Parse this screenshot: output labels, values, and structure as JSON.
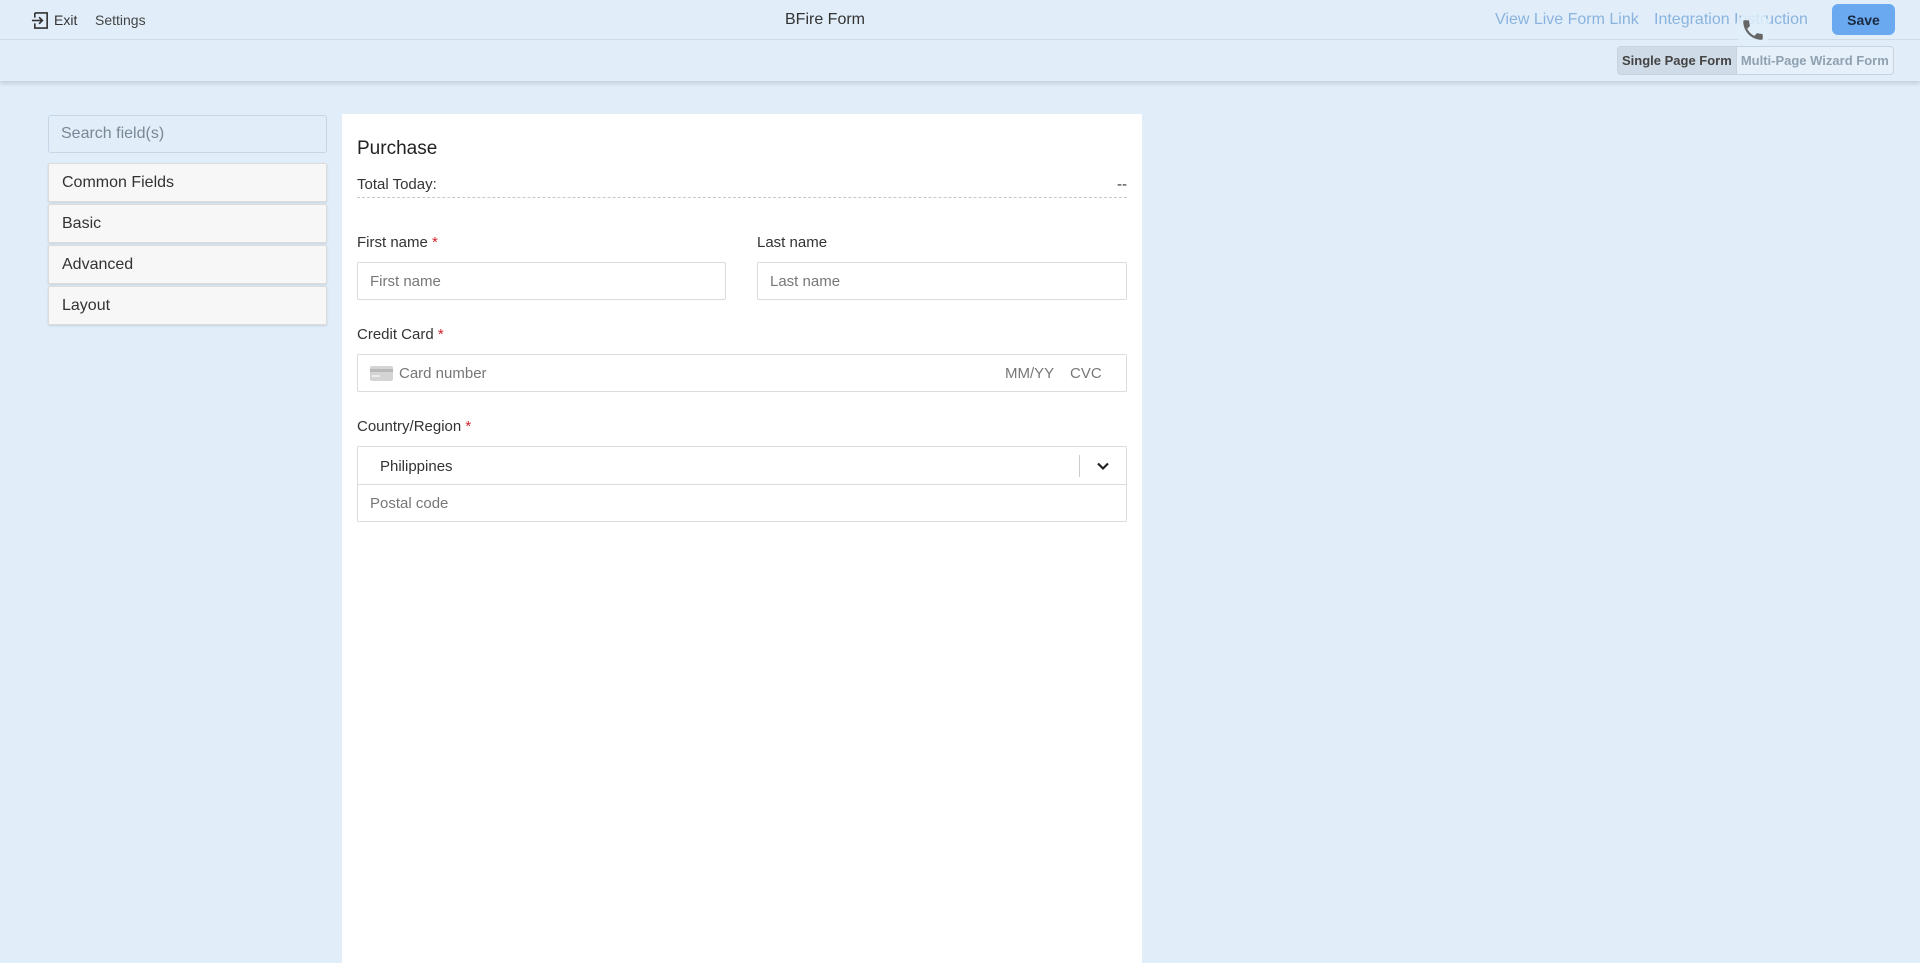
{
  "header": {
    "exit_label": "Exit",
    "settings_label": "Settings",
    "title": "BFire Form",
    "live_link_label": "View Live Form Link",
    "integration_label": "Integration Instruction",
    "save_label": "Save"
  },
  "mode_toggle": {
    "single_page_label": "Single Page Form",
    "multi_page_label": "Multi-Page Wizard Form",
    "active": "Single Page Form"
  },
  "sidebar": {
    "search_placeholder": "Search field(s)",
    "categories": [
      {
        "label": "Common Fields"
      },
      {
        "label": "Basic"
      },
      {
        "label": "Advanced"
      },
      {
        "label": "Layout"
      }
    ]
  },
  "form": {
    "title": "Purchase",
    "total_label": "Total Today:",
    "total_value": "--",
    "first_name": {
      "label": "First name",
      "required_mark": "*",
      "placeholder": "First name"
    },
    "last_name": {
      "label": "Last name",
      "placeholder": "Last name"
    },
    "credit_card": {
      "label": "Credit Card",
      "required_mark": "*",
      "number_placeholder": "Card number",
      "expiry_placeholder": "MM/YY",
      "cvc_placeholder": "CVC"
    },
    "country": {
      "label": "Country/Region",
      "required_mark": "*",
      "selected": "Philippines"
    },
    "postal_code": {
      "placeholder": "Postal code"
    }
  },
  "colors": {
    "page_background": "#e1eefa",
    "link": "#8ab3de",
    "save_button": "#6aa9f0",
    "required": "#d0242b"
  }
}
